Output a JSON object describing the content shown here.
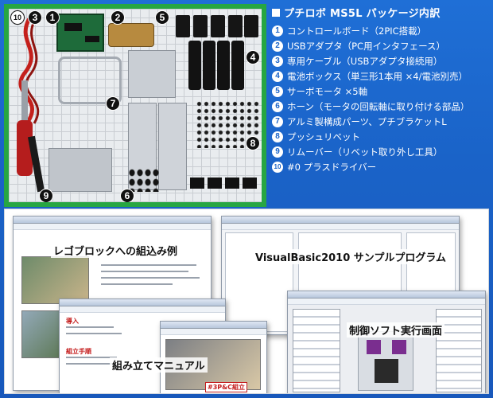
{
  "list": {
    "title": "プチロボ MS5L パッケージ内訳",
    "items": [
      {
        "n": "1",
        "text": "コントロールボード（2PIC搭載）"
      },
      {
        "n": "2",
        "text": "USBアダプタ（PC用インタフェース）"
      },
      {
        "n": "3",
        "text": "専用ケーブル（USBアダプタ接続用）"
      },
      {
        "n": "4",
        "text": "電池ボックス（単三形1本用 ×4/電池別売）"
      },
      {
        "n": "5",
        "text": "サーボモータ ×5軸"
      },
      {
        "n": "6",
        "text": "ホーン（モータの回転軸に取り付ける部品）"
      },
      {
        "n": "7",
        "text": "アルミ製構成パーツ、プチブラケットL"
      },
      {
        "n": "8",
        "text": "プッシュリベット"
      },
      {
        "n": "9",
        "text": "リムーバー（リベット取り外し工具）"
      },
      {
        "n": "10",
        "text": "#0 プラスドライバー"
      }
    ]
  },
  "photo_markers": [
    "10",
    "3",
    "1",
    "2",
    "5",
    "4",
    "7",
    "8",
    "9",
    "6"
  ],
  "collage": {
    "cap_lego": "レゴブロックへの組込み例",
    "cap_vb": "VisualBasic2010 サンプルプログラム",
    "cap_manual": "組み立てマニュアル",
    "cap_control": "制御ソフト実行画面",
    "manual_heading1": "導入",
    "manual_heading2": "組立手順",
    "manual_badge": "#3P&C組立"
  },
  "colors": {
    "background": "#1a63c8",
    "photo_frame": "#27a642",
    "text": "#ffffff"
  }
}
